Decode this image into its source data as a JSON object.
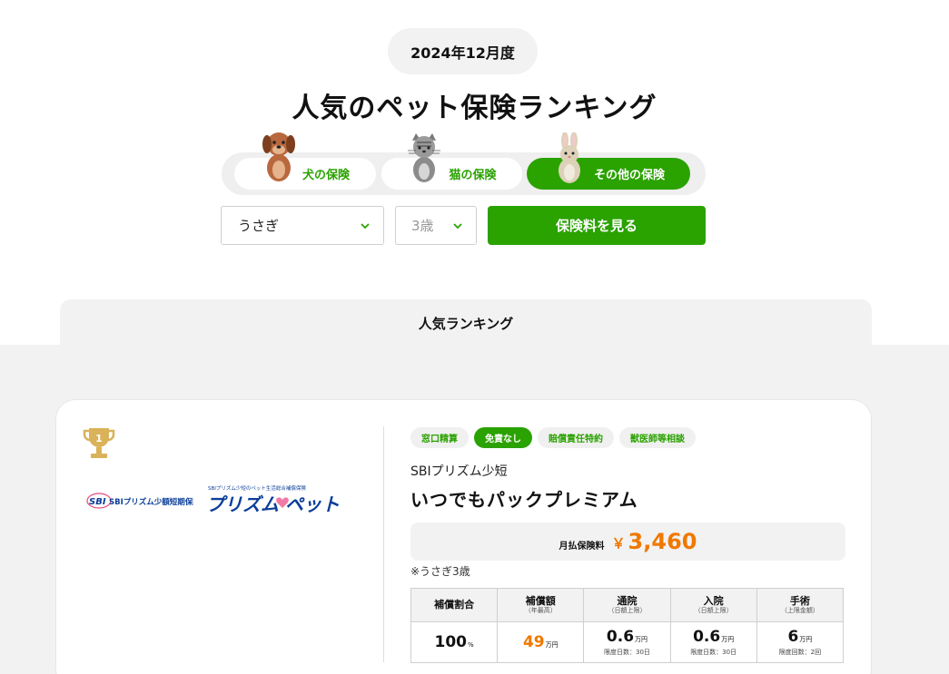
{
  "header": {
    "month": "2024年12月度",
    "title": "人気のペット保険ランキング"
  },
  "tabs": [
    {
      "label": "犬の保険",
      "icon": "dog-icon",
      "active": false
    },
    {
      "label": "猫の保険",
      "icon": "cat-icon",
      "active": false
    },
    {
      "label": "その他の保険",
      "icon": "rabbit-icon",
      "active": true
    }
  ],
  "filters": {
    "pet_value": "うさぎ",
    "age_placeholder": "3歳",
    "submit_label": "保険料を見る"
  },
  "ranking": {
    "section_label": "人気ランキング",
    "items": [
      {
        "rank": "1",
        "logos": {
          "insurer": "SBIプリズム少額短期保険",
          "product_caption": "SBIプリズム少短のペット生活総合補償保険",
          "product": "プリズム ペット"
        },
        "tags": [
          {
            "label": "窓口精算",
            "active": false
          },
          {
            "label": "免責なし",
            "active": true
          },
          {
            "label": "賠償責任特約",
            "active": false
          },
          {
            "label": "獣医師等相談",
            "active": false
          }
        ],
        "company": "SBIプリズム少短",
        "plan": "いつでもパックプレミアム",
        "price_label": "月払保険料",
        "price_currency": "￥",
        "price_value": "3,460",
        "note": "※うさぎ3歳",
        "specs": {
          "headers": [
            {
              "label": "補償割合",
              "sub": ""
            },
            {
              "label": "補償額",
              "sub": "（年最高）"
            },
            {
              "label": "通院",
              "sub": "（日額上限）"
            },
            {
              "label": "入院",
              "sub": "（日額上限）"
            },
            {
              "label": "手術",
              "sub": "（上限金額）"
            }
          ],
          "values": [
            {
              "value": "100",
              "unit": "%",
              "limit": ""
            },
            {
              "value": "49",
              "unit": "万円",
              "limit": ""
            },
            {
              "value": "0.6",
              "unit": "万円",
              "limit": "限度日数：30日"
            },
            {
              "value": "0.6",
              "unit": "万円",
              "limit": "限度日数：30日"
            },
            {
              "value": "6",
              "unit": "万円",
              "limit": "限度回数：2回"
            }
          ]
        }
      }
    ]
  },
  "colors": {
    "brand_green": "#2aa200",
    "price_orange": "#f07800",
    "logo_blue": "#0b3e99",
    "trophy_gold": "#d9b25a"
  }
}
